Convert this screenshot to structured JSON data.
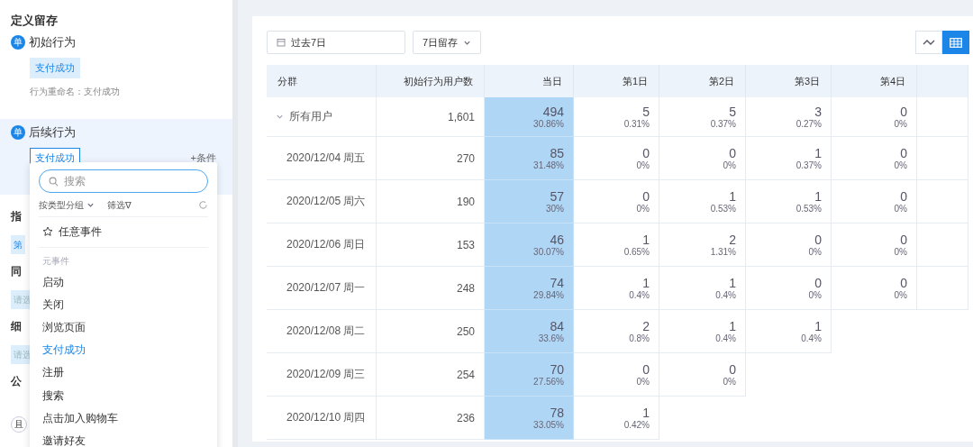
{
  "sidebar": {
    "title": "定义留存",
    "initial": {
      "badge": "单",
      "label": "初始行为",
      "event": "支付成功",
      "rename": "行为重命名：支付成功"
    },
    "followup": {
      "badge": "单",
      "label": "后续行为",
      "event": "支付成功",
      "add": "+条件"
    },
    "partial": [
      {
        "kind": "heading",
        "text": "指"
      },
      {
        "kind": "chip",
        "text": "第"
      },
      {
        "kind": "heading",
        "text": "同"
      },
      {
        "kind": "chip",
        "text": "请选"
      },
      {
        "kind": "heading",
        "text": "细"
      },
      {
        "kind": "chip",
        "text": "请选"
      },
      {
        "kind": "heading",
        "text": "公"
      },
      {
        "kind": "logic",
        "text": "且"
      }
    ]
  },
  "dropdown": {
    "search": {
      "placeholder": "搜索"
    },
    "group_by": "按类型分组",
    "filter": "筛选∇",
    "any_event": "任意事件",
    "section": "元事件",
    "items": [
      {
        "label": "启动",
        "selected": false
      },
      {
        "label": "关闭",
        "selected": false
      },
      {
        "label": "浏览页面",
        "selected": false
      },
      {
        "label": "支付成功",
        "selected": true
      },
      {
        "label": "注册",
        "selected": false
      },
      {
        "label": "搜索",
        "selected": false
      },
      {
        "label": "点击加入购物车",
        "selected": false
      },
      {
        "label": "邀请好友",
        "selected": false
      }
    ]
  },
  "toolbar": {
    "date_range": "过去7日",
    "retention": "7日留存",
    "views": [
      {
        "kind": "line",
        "selected": false
      },
      {
        "kind": "table",
        "selected": true
      }
    ]
  },
  "table": {
    "columns": [
      "分群",
      "初始行为用户数",
      "当日",
      "第1日",
      "第2日",
      "第3日",
      "第4日"
    ],
    "rows": [
      {
        "kind": "total",
        "expanded": true,
        "cells": [
          {
            "text": "所有用户"
          },
          {
            "text": "1,601"
          },
          {
            "count": "494",
            "pct": "30.86%"
          },
          {
            "count": "5",
            "pct": "0.31%"
          },
          {
            "count": "5",
            "pct": "0.37%"
          },
          {
            "count": "3",
            "pct": "0.27%"
          },
          {
            "count": "0",
            "pct": "0%"
          }
        ]
      },
      {
        "kind": "date",
        "cells": [
          {
            "text": "2020/12/04 周五"
          },
          {
            "text": "270"
          },
          {
            "count": "85",
            "pct": "31.48%"
          },
          {
            "count": "0",
            "pct": "0%"
          },
          {
            "count": "0",
            "pct": "0%"
          },
          {
            "count": "1",
            "pct": "0.37%"
          },
          {
            "count": "0",
            "pct": "0%"
          }
        ]
      },
      {
        "kind": "date",
        "cells": [
          {
            "text": "2020/12/05 周六"
          },
          {
            "text": "190"
          },
          {
            "count": "57",
            "pct": "30%"
          },
          {
            "count": "0",
            "pct": "0%"
          },
          {
            "count": "1",
            "pct": "0.53%"
          },
          {
            "count": "1",
            "pct": "0.53%"
          },
          {
            "count": "0",
            "pct": "0%"
          }
        ]
      },
      {
        "kind": "date",
        "cells": [
          {
            "text": "2020/12/06 周日"
          },
          {
            "text": "153"
          },
          {
            "count": "46",
            "pct": "30.07%"
          },
          {
            "count": "1",
            "pct": "0.65%"
          },
          {
            "count": "2",
            "pct": "1.31%"
          },
          {
            "count": "0",
            "pct": "0%"
          },
          {
            "count": "0",
            "pct": "0%"
          }
        ]
      },
      {
        "kind": "date",
        "cells": [
          {
            "text": "2020/12/07 周一"
          },
          {
            "text": "248"
          },
          {
            "count": "74",
            "pct": "29.84%"
          },
          {
            "count": "1",
            "pct": "0.4%"
          },
          {
            "count": "1",
            "pct": "0.4%"
          },
          {
            "count": "0",
            "pct": "0%"
          },
          {
            "count": "0",
            "pct": "0%"
          }
        ]
      },
      {
        "kind": "date",
        "cells": [
          {
            "text": "2020/12/08 周二"
          },
          {
            "text": "250"
          },
          {
            "count": "84",
            "pct": "33.6%"
          },
          {
            "count": "2",
            "pct": "0.8%"
          },
          {
            "count": "1",
            "pct": "0.4%"
          },
          {
            "count": "1",
            "pct": "0.4%"
          }
        ]
      },
      {
        "kind": "date",
        "cells": [
          {
            "text": "2020/12/09 周三"
          },
          {
            "text": "254"
          },
          {
            "count": "70",
            "pct": "27.56%"
          },
          {
            "count": "0",
            "pct": "0%"
          },
          {
            "count": "0",
            "pct": "0%"
          }
        ]
      },
      {
        "kind": "date",
        "cells": [
          {
            "text": "2020/12/10 周四"
          },
          {
            "text": "236"
          },
          {
            "count": "78",
            "pct": "33.05%"
          },
          {
            "count": "1",
            "pct": "0.42%"
          }
        ]
      }
    ]
  }
}
